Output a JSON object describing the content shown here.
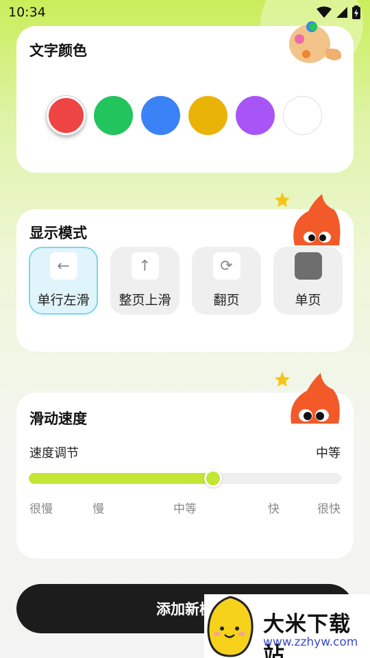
{
  "status_bar": {
    "time": "10:34"
  },
  "text_color": {
    "title": "文字颜色",
    "swatches": [
      {
        "name": "red",
        "color": "#ee4444",
        "selected": true
      },
      {
        "name": "green",
        "color": "#22c45e",
        "selected": false
      },
      {
        "name": "blue",
        "color": "#3b82f6",
        "selected": false
      },
      {
        "name": "yellow",
        "color": "#eab308",
        "selected": false
      },
      {
        "name": "purple",
        "color": "#a855f7",
        "selected": false
      },
      {
        "name": "white",
        "color": "#ffffff",
        "selected": false
      }
    ]
  },
  "display_mode": {
    "title": "显示模式",
    "modes": [
      {
        "label": "单行左滑",
        "icon": "arrow-left-icon",
        "active": true
      },
      {
        "label": "整页上滑",
        "icon": "arrow-up-icon",
        "active": false
      },
      {
        "label": "翻页",
        "icon": "refresh-icon",
        "active": false
      },
      {
        "label": "单页",
        "icon": "square-icon",
        "active": false
      }
    ]
  },
  "scroll_speed": {
    "title": "滑动速度",
    "adjust_label": "速度调节",
    "current_value": "中等",
    "slider_level": 0.59,
    "ticks": [
      "很慢",
      "慢",
      "中等",
      "快",
      "很快"
    ]
  },
  "add_button": {
    "label": "添加新模"
  },
  "watermark": {
    "title": "大米下载站",
    "url": "www.zzhyw.com"
  },
  "colors": {
    "accent": "#c3e635",
    "active_mode_border": "#7bd5ea",
    "button_bg": "#1c1c1c"
  }
}
